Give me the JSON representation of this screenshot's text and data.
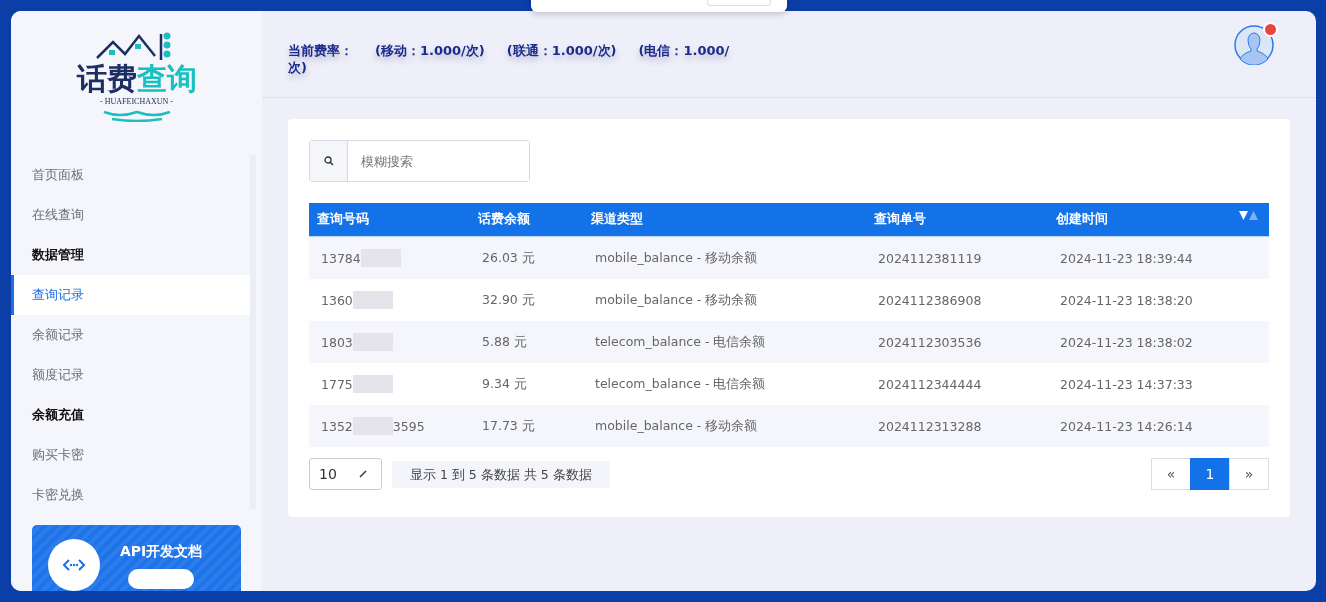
{
  "logo": {
    "title_dark": "话费",
    "title_accent": "查询",
    "subtitle": "- HUAFEICHAXUN -"
  },
  "sidebar": {
    "items": [
      {
        "kind": "link",
        "label": "首页面板",
        "selected": false
      },
      {
        "kind": "link",
        "label": "在线查询",
        "selected": false
      },
      {
        "kind": "heading",
        "label": "数据管理"
      },
      {
        "kind": "link",
        "label": "查询记录",
        "selected": true
      },
      {
        "kind": "link",
        "label": "余额记录",
        "selected": false
      },
      {
        "kind": "link",
        "label": "额度记录",
        "selected": false
      },
      {
        "kind": "heading",
        "label": "余额充值"
      },
      {
        "kind": "link",
        "label": "购买卡密",
        "selected": false
      },
      {
        "kind": "link",
        "label": "卡密兑换",
        "selected": false
      }
    ],
    "promo": {
      "title": "API开发文档"
    }
  },
  "header": {
    "rate_label": "当前费率：",
    "rates": [
      {
        "carrier": "(移动：",
        "value": "1.000/次)"
      },
      {
        "carrier": "(联通：",
        "value": "1.000/次)"
      },
      {
        "carrier": "(电信：",
        "value": "1.000/"
      }
    ],
    "rate_tail": "次)",
    "notification": true
  },
  "search": {
    "placeholder": "模糊搜索"
  },
  "table": {
    "columns": [
      "查询号码",
      "话费余额",
      "渠道类型",
      "查询单号",
      "创建时间"
    ],
    "rows": [
      {
        "phone_prefix": "13784",
        "phone_suffix": "",
        "balance": "26.03 元",
        "channel": "mobile_balance - 移动余额",
        "order": "2024112381119",
        "created": "2024-11-23 18:39:44"
      },
      {
        "phone_prefix": "1360",
        "phone_suffix": "",
        "balance": "32.90 元",
        "channel": "mobile_balance - 移动余额",
        "order": "2024112386908",
        "created": "2024-11-23 18:38:20"
      },
      {
        "phone_prefix": "1803",
        "phone_suffix": "",
        "balance": "5.88 元",
        "channel": "telecom_balance - 电信余额",
        "order": "2024112303536",
        "created": "2024-11-23 18:38:02"
      },
      {
        "phone_prefix": "1775",
        "phone_suffix": "",
        "balance": "9.34 元",
        "channel": "telecom_balance - 电信余额",
        "order": "2024112344444",
        "created": "2024-11-23 14:37:33"
      },
      {
        "phone_prefix": "1352",
        "phone_suffix": "3595",
        "balance": "17.73 元",
        "channel": "mobile_balance - 移动余额",
        "order": "2024112313288",
        "created": "2024-11-23 14:26:14"
      }
    ]
  },
  "footer": {
    "page_size": "10",
    "summary": "显示 1 到 5 条数据 共 5 条数据",
    "pages": [
      {
        "label": "«",
        "selected": false
      },
      {
        "label": "1",
        "selected": true
      },
      {
        "label": "»",
        "selected": false
      }
    ]
  }
}
